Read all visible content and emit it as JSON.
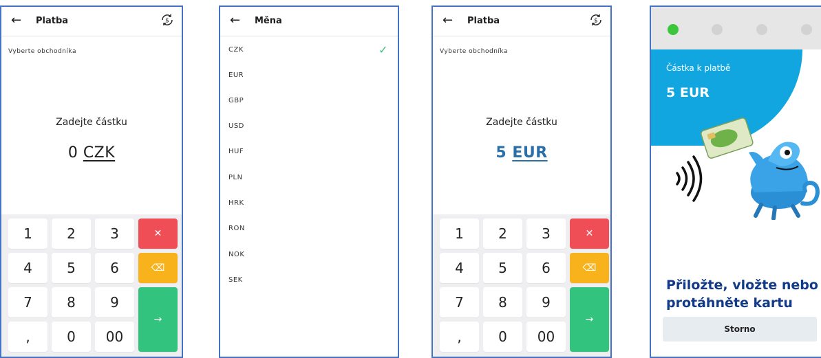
{
  "screen1": {
    "title": "Platba",
    "merchant_label": "Vyberte obchodníka",
    "prompt": "Zadejte částku",
    "amount_value": "0",
    "amount_currency": "CZK",
    "keys": [
      "1",
      "2",
      "3",
      "4",
      "5",
      "6",
      "7",
      "8",
      "9",
      ",",
      "0",
      "00"
    ],
    "clear_symbol": "✕",
    "backspace_symbol": "⌫",
    "enter_symbol": "→"
  },
  "screen2": {
    "title": "Měna",
    "currencies": [
      "CZK",
      "EUR",
      "GBP",
      "USD",
      "HUF",
      "PLN",
      "HRK",
      "RON",
      "NOK",
      "SEK"
    ],
    "selected": "CZK",
    "check_symbol": "✓"
  },
  "screen3": {
    "title": "Platba",
    "merchant_label": "Vyberte obchodníka",
    "prompt": "Zadejte částku",
    "amount_value": "5",
    "amount_currency": "EUR",
    "keys": [
      "1",
      "2",
      "3",
      "4",
      "5",
      "6",
      "7",
      "8",
      "9",
      ",",
      "0",
      "00"
    ],
    "clear_symbol": "✕",
    "backspace_symbol": "⌫",
    "enter_symbol": "→"
  },
  "screen4": {
    "amount_label": "Částka k platbě",
    "amount": "5 EUR",
    "instruction": "Přiložte, vložte nebo protáhněte kartu",
    "cancel_label": "Storno",
    "status_dots": [
      "active",
      "inactive",
      "inactive",
      "inactive"
    ]
  },
  "icons": {
    "back": "arrow-left-icon",
    "convert": "currency-exchange-icon",
    "check": "check-icon",
    "contactless": "contactless-icon"
  },
  "colors": {
    "frame": "#4472c4",
    "clear": "#f04e57",
    "backspace": "#f7b21c",
    "enter": "#32c37e",
    "check": "#3cbf7b",
    "amount_selected": "#2b6fa8",
    "pay_blue": "#12a6e0",
    "instruction": "#123a8a",
    "dot_active": "#3cc63c",
    "dot_inactive": "#d2d2d2"
  }
}
